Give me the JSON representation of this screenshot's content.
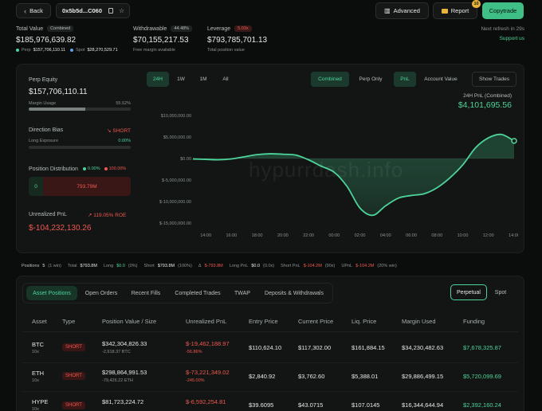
{
  "header": {
    "back_label": "Back",
    "address": "0x5b5d...C060",
    "advanced_label": "Advanced",
    "report_label": "Report",
    "report_badge": "10",
    "copytrade_label": "Copytrade",
    "refresh_text": "Next refresh in 29s",
    "support_text": "Support us"
  },
  "summary": {
    "total_value_label": "Total Value",
    "combined_tag": "Combined",
    "total_value": "$185,976,639.82",
    "perp_label": "Perp",
    "perp_value": "$157,706,110.11",
    "spot_label": "Spot",
    "spot_value": "$28,270,529.71",
    "withdrawable_label": "Withdrawable",
    "withdrawable_pct": "44.48%",
    "withdrawable_value": "$70,155,217.53",
    "withdrawable_sub": "Free margin available",
    "leverage_label": "Leverage",
    "leverage_tag": "5.03x",
    "leverage_value": "$793,785,701.13",
    "leverage_sub": "Total position value"
  },
  "left_panel": {
    "perp_equity_label": "Perp Equity",
    "perp_equity_value": "$157,706,110.11",
    "margin_usage_label": "Margin Usage",
    "margin_usage_pct": "55.52%",
    "margin_usage_fraction": 0.5552,
    "direction_bias_label": "Direction Bias",
    "direction_bias_value": "SHORT",
    "long_exposure_label": "Long Exposure",
    "long_exposure_pct": "0.00%",
    "position_distribution_label": "Position Distribution",
    "dist_long_pct": "0.00%",
    "dist_short_pct": "100.00%",
    "dist_long_value": "0",
    "dist_short_value": "793.79M",
    "unrealized_label": "Unrealized PnL",
    "roe_text": "119.05% ROE",
    "unrealized_value": "$-104,232,130.26"
  },
  "chart_controls": {
    "timeframes": [
      "24H",
      "1W",
      "1M",
      "All"
    ],
    "modes": [
      "Combined",
      "Perp Only"
    ],
    "metrics": [
      "PnL",
      "Account Value"
    ],
    "show_trades": "Show Trades",
    "pnl_caption": "24H PnL (Combined)",
    "pnl_value": "$4,101,695.56",
    "watermark": "hypurrdash.info"
  },
  "chart_data": {
    "type": "area",
    "x": [
      "13:00",
      "14:00",
      "15:00",
      "16:00",
      "17:00",
      "18:00",
      "19:00",
      "20:00",
      "21:00",
      "22:00",
      "23:00",
      "00:00",
      "01:00",
      "02:00",
      "03:00",
      "04:00",
      "05:00",
      "06:00",
      "07:00",
      "08:00",
      "09:00",
      "10:00",
      "11:00",
      "12:00",
      "13:00",
      "14:00"
    ],
    "y": [
      -0.1,
      -0.2,
      -0.3,
      -0.1,
      0.4,
      0.9,
      1.1,
      1.0,
      0.8,
      -0.3,
      -1.8,
      -3.2,
      -6.5,
      -11.5,
      -13.2,
      -11.0,
      -9.2,
      -8.6,
      -8.2,
      -6.8,
      -4.5,
      -1.5,
      2.5,
      4.8,
      5.6,
      4.1
    ],
    "y_unit": "millions USD",
    "ylim": [
      -15,
      10
    ],
    "yticks": [
      "$10,000,000.00",
      "$5,000,000.00",
      "$0.00",
      "$-5,000,000.00",
      "$-10,000,000.00",
      "$-15,000,000.00"
    ],
    "ytick_values": [
      10,
      5,
      0,
      -5,
      -10,
      -15
    ],
    "xticks": [
      "14:00",
      "16:00",
      "18:00",
      "20:00",
      "22:00",
      "00:00",
      "02:00",
      "04:00",
      "06:00",
      "08:00",
      "10:00",
      "12:00",
      "14:00"
    ],
    "grid": false,
    "line_color": "#4ed39a"
  },
  "stats_bar": {
    "positions": "Positions",
    "positions_count": "5",
    "positions_win": "(1 win)",
    "total_label": "Total",
    "total_value": "$793.8M",
    "long_label": "Long",
    "long_value": "$0.0",
    "long_pct": "(0%)",
    "short_label": "Short",
    "short_value": "$793.8M",
    "short_pct": "(100%)",
    "delta_label": "Δ",
    "delta_value": "$-793.8M",
    "long_pnl_label": "Long PnL",
    "long_pnl_value": "$0.0",
    "long_pnl_pct": "(0.0x)",
    "short_pnl_label": "Short PnL",
    "short_pnl_value": "$-104.2M",
    "short_pnl_pct": "(90x)",
    "upnl_label": "UPnL",
    "upnl_value": "$-104.2M",
    "upnl_win": "(20% win)"
  },
  "tabs": [
    "Asset Positions",
    "Open Orders",
    "Recent Fills",
    "Completed Trades",
    "TWAP",
    "Deposits & Withdrawals"
  ],
  "market_toggle": [
    "Perpetual",
    "Spot"
  ],
  "table": {
    "headers": [
      "Asset",
      "Type",
      "Position Value / Size",
      "Unrealized PnL",
      "Entry Price",
      "Current Price",
      "Liq. Price",
      "Margin Used",
      "Funding"
    ],
    "rows": [
      {
        "asset": "BTC",
        "lev": "10x",
        "type": "SHORT",
        "value": "$342,304,826.33",
        "size": "-2,918.37 BTC",
        "pnl": "$-19,462,188.97",
        "pnl_pct": "-56.86%",
        "entry": "$110,624.10",
        "current": "$117,302.00",
        "liq": "$161,884.15",
        "margin": "$34,230,482.63",
        "funding": "$7,678,325.87"
      },
      {
        "asset": "ETH",
        "lev": "10x",
        "type": "SHORT",
        "value": "$298,864,991.53",
        "size": "-79,426.22 ETH",
        "pnl": "$-73,221,349.02",
        "pnl_pct": "-245.00%",
        "entry": "$2,840.92",
        "current": "$3,762.60",
        "liq": "$5,388.01",
        "margin": "$29,886,499.15",
        "funding": "$5,720,099.69"
      },
      {
        "asset": "HYPE",
        "lev": "10x",
        "type": "SHORT",
        "value": "$81,723,224.72",
        "size": "",
        "pnl": "$-6,592,254.81",
        "pnl_pct": "",
        "entry": "$39.6095",
        "current": "$43.0715",
        "liq": "$107.0145",
        "margin": "$16,344,644.94",
        "funding": "$2,392,160.24"
      }
    ]
  }
}
